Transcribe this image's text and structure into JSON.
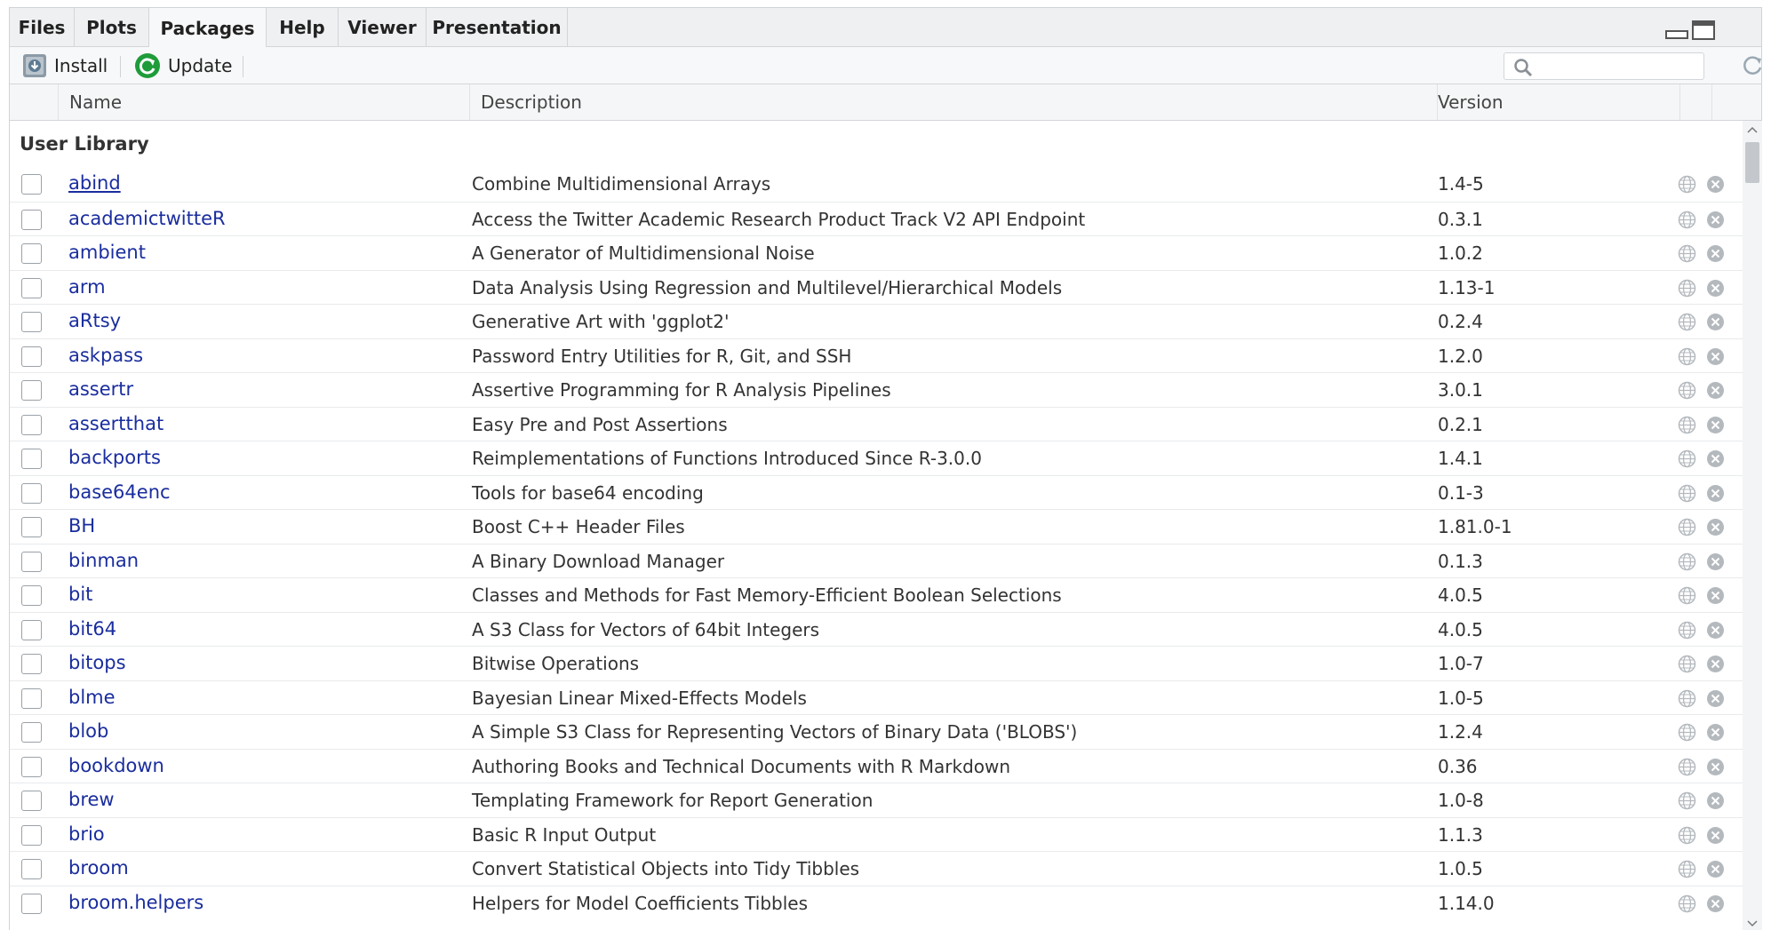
{
  "tabs": [
    {
      "label": "Files"
    },
    {
      "label": "Plots"
    },
    {
      "label": "Packages"
    },
    {
      "label": "Help"
    },
    {
      "label": "Viewer"
    },
    {
      "label": "Presentation"
    }
  ],
  "toolbar": {
    "install_label": "Install",
    "update_label": "Update",
    "search_placeholder": ""
  },
  "table": {
    "columns": [
      "Name",
      "Description",
      "Version"
    ],
    "section_label": "User Library",
    "rows": [
      {
        "name": "abind",
        "description": "Combine Multidimensional Arrays",
        "version": "1.4-5"
      },
      {
        "name": "academictwitteR",
        "description": "Access the Twitter Academic Research Product Track V2 API Endpoint",
        "version": "0.3.1"
      },
      {
        "name": "ambient",
        "description": "A Generator of Multidimensional Noise",
        "version": "1.0.2"
      },
      {
        "name": "arm",
        "description": "Data Analysis Using Regression and Multilevel/Hierarchical Models",
        "version": "1.13-1"
      },
      {
        "name": "aRtsy",
        "description": "Generative Art with 'ggplot2'",
        "version": "0.2.4"
      },
      {
        "name": "askpass",
        "description": "Password Entry Utilities for R, Git, and SSH",
        "version": "1.2.0"
      },
      {
        "name": "assertr",
        "description": "Assertive Programming for R Analysis Pipelines",
        "version": "3.0.1"
      },
      {
        "name": "assertthat",
        "description": "Easy Pre and Post Assertions",
        "version": "0.2.1"
      },
      {
        "name": "backports",
        "description": "Reimplementations of Functions Introduced Since R-3.0.0",
        "version": "1.4.1"
      },
      {
        "name": "base64enc",
        "description": "Tools for base64 encoding",
        "version": "0.1-3"
      },
      {
        "name": "BH",
        "description": "Boost C++ Header Files",
        "version": "1.81.0-1"
      },
      {
        "name": "binman",
        "description": "A Binary Download Manager",
        "version": "0.1.3"
      },
      {
        "name": "bit",
        "description": "Classes and Methods for Fast Memory-Efficient Boolean Selections",
        "version": "4.0.5"
      },
      {
        "name": "bit64",
        "description": "A S3 Class for Vectors of 64bit Integers",
        "version": "4.0.5"
      },
      {
        "name": "bitops",
        "description": "Bitwise Operations",
        "version": "1.0-7"
      },
      {
        "name": "blme",
        "description": "Bayesian Linear Mixed-Effects Models",
        "version": "1.0-5"
      },
      {
        "name": "blob",
        "description": "A Simple S3 Class for Representing Vectors of Binary Data ('BLOBS')",
        "version": "1.2.4"
      },
      {
        "name": "bookdown",
        "description": "Authoring Books and Technical Documents with R Markdown",
        "version": "0.36"
      },
      {
        "name": "brew",
        "description": "Templating Framework for Report Generation",
        "version": "1.0-8"
      },
      {
        "name": "brio",
        "description": "Basic R Input Output",
        "version": "1.1.3"
      },
      {
        "name": "broom",
        "description": "Convert Statistical Objects into Tidy Tibbles",
        "version": "1.0.5"
      },
      {
        "name": "broom.helpers",
        "description": "Helpers for Model Coefficients Tibbles",
        "version": "1.14.0"
      }
    ]
  },
  "colors": {
    "link": "#1a2d9e",
    "update_icon": "#1e9c3a",
    "tabbar_bg": "#eef0f2"
  },
  "icons": {
    "install": "install-icon",
    "update": "update-icon",
    "search": "search-icon",
    "refresh": "refresh-icon",
    "website": "globe-icon",
    "remove": "remove-icon"
  }
}
